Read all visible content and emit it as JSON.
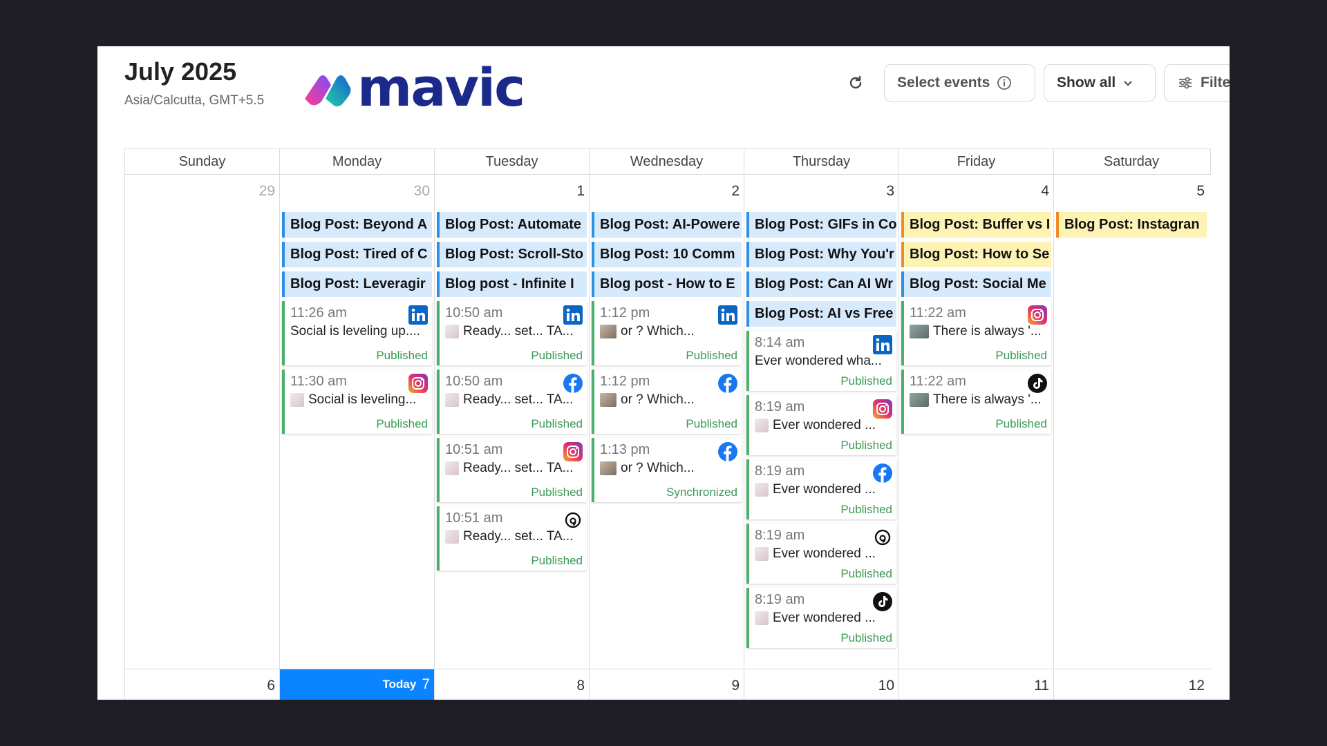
{
  "header": {
    "month": "July 2025",
    "timezone": "Asia/Calcutta, GMT+5.5",
    "logo_text": "mavic"
  },
  "toolbar": {
    "select_events": "Select events",
    "show_all": "Show all",
    "filters": "Filte"
  },
  "weekdays": [
    "Sunday",
    "Monday",
    "Tuesday",
    "Wednesday",
    "Thursday",
    "Friday",
    "Saturday"
  ],
  "week1": {
    "days": [
      "29",
      "30",
      "1",
      "2",
      "3",
      "4",
      "5"
    ]
  },
  "week2": {
    "days": [
      "6",
      "7",
      "8",
      "9",
      "10",
      "11",
      "12"
    ],
    "today_label": "Today"
  },
  "monday": {
    "blogs": [
      "Blog Post: Beyond A",
      "Blog Post: Tired of C",
      "Blog Post: Leveragir"
    ],
    "posts": [
      {
        "time": "11:26 am",
        "text": "Social is leveling up....",
        "status": "Published",
        "network": "linkedin-icon"
      },
      {
        "time": "11:30 am",
        "text": "Social is leveling...",
        "status": "Published",
        "network": "instagram-icon"
      }
    ]
  },
  "tuesday": {
    "blogs": [
      "Blog Post: Automate",
      "Blog Post: Scroll-Sto",
      "Blog post - Infinite I"
    ],
    "posts": [
      {
        "time": "10:50 am",
        "text": "Ready... set... TA...",
        "status": "Published",
        "network": "linkedin-icon"
      },
      {
        "time": "10:50 am",
        "text": "Ready... set... TA...",
        "status": "Published",
        "network": "facebook-icon"
      },
      {
        "time": "10:51 am",
        "text": "Ready... set... TA...",
        "status": "Published",
        "network": "instagram-icon"
      },
      {
        "time": "10:51 am",
        "text": "Ready... set... TA...",
        "status": "Published",
        "network": "threads-icon"
      }
    ]
  },
  "wednesday": {
    "blogs": [
      "Blog Post: AI-Powere",
      "Blog Post: 10 Comm",
      "Blog post - How to E"
    ],
    "posts": [
      {
        "time": "1:12 pm",
        "text": "or  ? Which...",
        "status": "Published",
        "network": "linkedin-icon"
      },
      {
        "time": "1:12 pm",
        "text": "or  ? Which...",
        "status": "Published",
        "network": "facebook-icon"
      },
      {
        "time": "1:13 pm",
        "text": "or  ? Which...",
        "status": "Synchronized",
        "network": "facebook-icon"
      }
    ]
  },
  "thursday": {
    "blogs": [
      "Blog Post: GIFs in Co",
      "Blog Post: Why You'r",
      "Blog Post: Can AI Wr",
      "Blog Post: AI vs Free"
    ],
    "posts": [
      {
        "time": "8:14 am",
        "text": "Ever wondered wha...",
        "status": "Published",
        "network": "linkedin-icon"
      },
      {
        "time": "8:19 am",
        "text": "Ever wondered ...",
        "status": "Published",
        "network": "instagram-icon"
      },
      {
        "time": "8:19 am",
        "text": "Ever wondered ...",
        "status": "Published",
        "network": "facebook-icon"
      },
      {
        "time": "8:19 am",
        "text": "Ever wondered ...",
        "status": "Published",
        "network": "threads-icon"
      },
      {
        "time": "8:19 am",
        "text": "Ever wondered ...",
        "status": "Published",
        "network": "tiktok-icon"
      }
    ]
  },
  "friday": {
    "blogs": [
      "Blog Post: Buffer vs I",
      "Blog Post: How to Se",
      "Blog Post: Social Me"
    ],
    "posts": [
      {
        "time": "11:22 am",
        "text": "There is always '...",
        "status": "Published",
        "network": "instagram-icon"
      },
      {
        "time": "11:22 am",
        "text": "There is always '...",
        "status": "Published",
        "network": "tiktok-icon"
      }
    ]
  },
  "saturday": {
    "blogs": [
      "Blog Post: Instagran"
    ]
  },
  "colors": {
    "blog_blue_bg": "#d6eafc",
    "blog_blue_border": "#2c8fe6",
    "blog_yellow_bg": "#fdf3b5",
    "blog_yellow_border": "#f08a24",
    "post_border": "#4caf6e",
    "today_bg": "#0a84ff",
    "logo_text": "#1b2a8a"
  }
}
